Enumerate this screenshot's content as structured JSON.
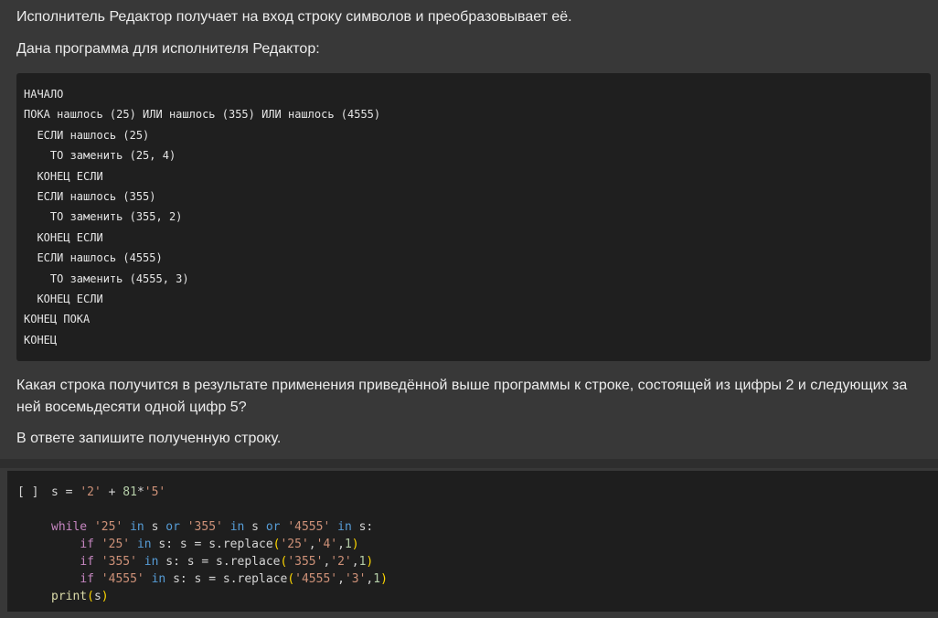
{
  "text_cell": {
    "intro": "Исполнитель Редактор получает на вход строку символов и преобразовывает её.",
    "program_intro": "Дана программа для исполнителя Редактор:",
    "program_lines": [
      "НАЧАЛО",
      "ПОКА нашлось (25) ИЛИ нашлось (355) ИЛИ нашлось (4555)",
      "  ЕСЛИ нашлось (25)",
      "    ТО заменить (25, 4)",
      "  КОНЕЦ ЕСЛИ",
      "  ЕСЛИ нашлось (355)",
      "    ТО заменить (355, 2)",
      "  КОНЕЦ ЕСЛИ",
      "  ЕСЛИ нашлось (4555)",
      "    ТО заменить (4555, 3)",
      "  КОНЕЦ ЕСЛИ",
      "КОНЕЦ ПОКА",
      "КОНЕЦ"
    ],
    "question": "Какая строка получится в результате применения приведённой выше программы к строке, состоящей из цифры 2 и следующих за ней восемьдесяти одной цифр 5?",
    "answer_prompt": "В ответе запишите полученную строку."
  },
  "code_cell": {
    "run_indicator": "[ ]",
    "lines": [
      [
        {
          "t": "s = ",
          "c": "op"
        },
        {
          "t": "'2'",
          "c": "str"
        },
        {
          "t": " + ",
          "c": "op"
        },
        {
          "t": "81",
          "c": "num"
        },
        {
          "t": "*",
          "c": "op"
        },
        {
          "t": "'5'",
          "c": "str"
        }
      ],
      [],
      [
        {
          "t": "while ",
          "c": "ctl"
        },
        {
          "t": "'25'",
          "c": "str"
        },
        {
          "t": " ",
          "c": "op"
        },
        {
          "t": "in",
          "c": "bl"
        },
        {
          "t": " s ",
          "c": "op"
        },
        {
          "t": "or",
          "c": "bl"
        },
        {
          "t": " ",
          "c": "op"
        },
        {
          "t": "'355'",
          "c": "str"
        },
        {
          "t": " ",
          "c": "op"
        },
        {
          "t": "in",
          "c": "bl"
        },
        {
          "t": " s ",
          "c": "op"
        },
        {
          "t": "or",
          "c": "bl"
        },
        {
          "t": " ",
          "c": "op"
        },
        {
          "t": "'4555'",
          "c": "str"
        },
        {
          "t": " ",
          "c": "op"
        },
        {
          "t": "in",
          "c": "bl"
        },
        {
          "t": " s:",
          "c": "op"
        }
      ],
      [
        {
          "t": "    ",
          "c": "op"
        },
        {
          "t": "if",
          "c": "ctl"
        },
        {
          "t": " ",
          "c": "op"
        },
        {
          "t": "'25'",
          "c": "str"
        },
        {
          "t": " ",
          "c": "op"
        },
        {
          "t": "in",
          "c": "bl"
        },
        {
          "t": " s: s = s.replace",
          "c": "op"
        },
        {
          "t": "(",
          "c": "paren"
        },
        {
          "t": "'25'",
          "c": "str"
        },
        {
          "t": ",",
          "c": "op"
        },
        {
          "t": "'4'",
          "c": "str"
        },
        {
          "t": ",",
          "c": "op"
        },
        {
          "t": "1",
          "c": "num"
        },
        {
          "t": ")",
          "c": "paren"
        }
      ],
      [
        {
          "t": "    ",
          "c": "op"
        },
        {
          "t": "if",
          "c": "ctl"
        },
        {
          "t": " ",
          "c": "op"
        },
        {
          "t": "'355'",
          "c": "str"
        },
        {
          "t": " ",
          "c": "op"
        },
        {
          "t": "in",
          "c": "bl"
        },
        {
          "t": " s: s = s.replace",
          "c": "op"
        },
        {
          "t": "(",
          "c": "paren"
        },
        {
          "t": "'355'",
          "c": "str"
        },
        {
          "t": ",",
          "c": "op"
        },
        {
          "t": "'2'",
          "c": "str"
        },
        {
          "t": ",",
          "c": "op"
        },
        {
          "t": "1",
          "c": "num"
        },
        {
          "t": ")",
          "c": "paren"
        }
      ],
      [
        {
          "t": "    ",
          "c": "op"
        },
        {
          "t": "if",
          "c": "ctl"
        },
        {
          "t": " ",
          "c": "op"
        },
        {
          "t": "'4555'",
          "c": "str"
        },
        {
          "t": " ",
          "c": "op"
        },
        {
          "t": "in",
          "c": "bl"
        },
        {
          "t": " s: s = s.replace",
          "c": "op"
        },
        {
          "t": "(",
          "c": "paren"
        },
        {
          "t": "'4555'",
          "c": "str"
        },
        {
          "t": ",",
          "c": "op"
        },
        {
          "t": "'3'",
          "c": "str"
        },
        {
          "t": ",",
          "c": "op"
        },
        {
          "t": "1",
          "c": "num"
        },
        {
          "t": ")",
          "c": "paren"
        }
      ],
      [
        {
          "t": "print",
          "c": "fn"
        },
        {
          "t": "(",
          "c": "paren"
        },
        {
          "t": "s",
          "c": "op"
        },
        {
          "t": ")",
          "c": "paren"
        }
      ]
    ]
  },
  "colors": {
    "page_background": "#383838",
    "code_background": "#1e1e1e",
    "keyword": "#c586c0",
    "builtin_operator": "#569cd6",
    "string": "#ce9178",
    "number": "#b5cea8",
    "function": "#dcdcaa",
    "bracket": "#ffd700"
  }
}
